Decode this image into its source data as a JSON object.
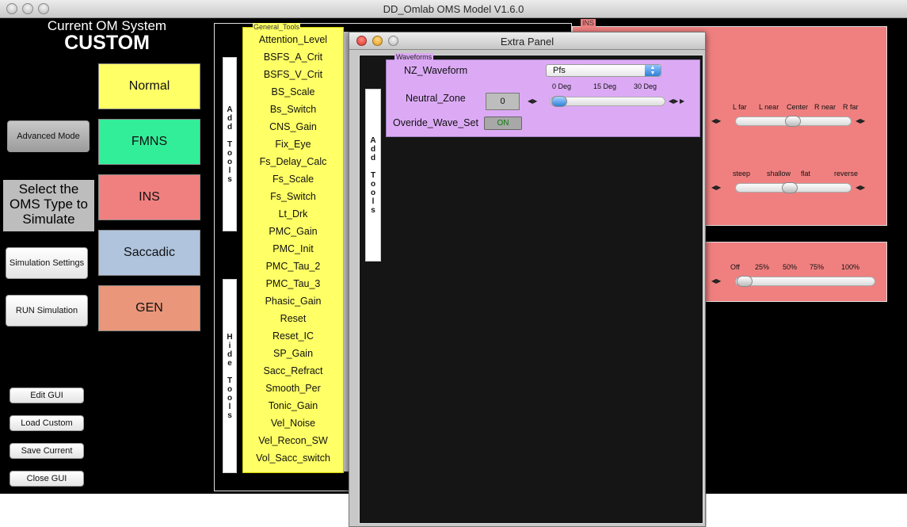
{
  "window": {
    "title": "DD_Omlab OMS Model V1.6.0"
  },
  "header": {
    "current_label": "Current OM System",
    "current_value": "CUSTOM"
  },
  "left": {
    "advanced_mode": "Advanced Mode",
    "select_label": "Select the OMS Type to Simulate",
    "simulation_settings": "Simulation Settings",
    "run_simulation": "RUN Simulation",
    "edit_gui": "Edit GUI",
    "load_custom": "Load Custom",
    "save_current": "Save Current",
    "close_gui": "Close GUI"
  },
  "types": [
    {
      "label": "Normal",
      "color": "#ffff66"
    },
    {
      "label": "FMNS",
      "color": "#33ee99"
    },
    {
      "label": "INS",
      "color": "#f08080"
    },
    {
      "label": "Saccadic",
      "color": "#b0c4de"
    },
    {
      "label": "GEN",
      "color": "#e9967a"
    }
  ],
  "tools": {
    "add_tools": "Add Tools",
    "hide_tools": "Hide Tools",
    "general_tools_label": "General_Tools",
    "items": [
      "Attention_Level",
      "BSFS_A_Crit",
      "BSFS_V_Crit",
      "BS_Scale",
      "Bs_Switch",
      "CNS_Gain",
      "Fix_Eye",
      "Fs_Delay_Calc",
      "Fs_Scale",
      "Fs_Switch",
      "Lt_Drk",
      "PMC_Gain",
      "PMC_Init",
      "PMC_Tau_2",
      "PMC_Tau_3",
      "Phasic_Gain",
      "Reset",
      "Reset_IC",
      "SP_Gain",
      "Sacc_Refract",
      "Smooth_Per",
      "Tonic_Gain",
      "Vel_Noise",
      "Vel_Recon_SW",
      "Vol_Sacc_switch"
    ]
  },
  "ins": {
    "tag": "INS",
    "slider1_ticks": [
      "L far",
      "L near",
      "Center",
      "R near",
      "R far"
    ],
    "slider2_ticks": [
      "steep",
      "shallow",
      "flat",
      "reverse"
    ],
    "slider3_ticks": [
      "Off",
      "25%",
      "50%",
      "75%",
      "100%"
    ]
  },
  "extra_panel": {
    "title": "Extra Panel",
    "add_tools": "Add Tools",
    "waveforms_tag": "Waveforms",
    "nz_waveform_label": "NZ_Waveform",
    "nz_waveform_value": "Pfs",
    "neutral_zone_label": "Neutral_Zone",
    "neutral_zone_value": "0",
    "nz_ticks": [
      "0 Deg",
      "15 Deg",
      "30 Deg"
    ],
    "override_label": "Overide_Wave_Set",
    "override_value": "ON"
  }
}
